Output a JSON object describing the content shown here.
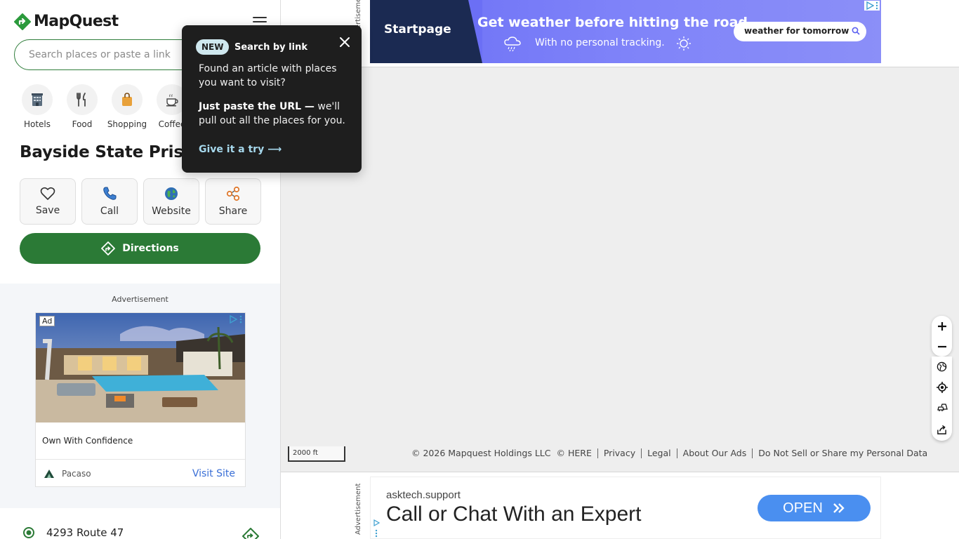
{
  "brand": {
    "name": "MapQuest"
  },
  "search": {
    "placeholder": "Search places or paste a link"
  },
  "categories": [
    {
      "label": "Hotels",
      "icon": "hotel-icon"
    },
    {
      "label": "Food",
      "icon": "fork-knife-icon"
    },
    {
      "label": "Shopping",
      "icon": "shopping-bag-icon"
    },
    {
      "label": "Coffee",
      "icon": "coffee-cup-icon"
    }
  ],
  "place": {
    "title": "Bayside State Prison",
    "actions": [
      {
        "label": "Save",
        "icon": "heart-icon"
      },
      {
        "label": "Call",
        "icon": "phone-icon"
      },
      {
        "label": "Website",
        "icon": "globe-icon"
      },
      {
        "label": "Share",
        "icon": "share-icon"
      }
    ],
    "directions_label": "Directions",
    "address": "4293 Route 47"
  },
  "popover": {
    "badge": "NEW",
    "title": "Search by link",
    "body1": "Found an article with places you want to visit?",
    "body2_bold": "Just paste the URL —",
    "body2_rest": " we'll pull out all the places for you.",
    "link": "Give it a try ⟶"
  },
  "left_ad": {
    "label": "Advertisement",
    "tag": "Ad",
    "headline": "Own With Confidence",
    "brand": "Pacaso",
    "cta": "Visit Site"
  },
  "top_ad": {
    "side_label": "Advertisement",
    "brand": "Startpage",
    "headline": "Get weather before hitting the road.",
    "sub": "With no personal tracking.",
    "search_text": "weather for tomorrow"
  },
  "map": {
    "scale_label": "2000 ft",
    "footer": {
      "copyright": "© 2026 Mapquest Holdings LLC",
      "here": "© HERE",
      "links": [
        "Privacy",
        "Legal",
        "About Our Ads",
        "Do Not Sell or Share my Personal Data"
      ]
    },
    "controls": [
      "zoom-in-icon",
      "zoom-out-icon",
      "globe-icon",
      "locate-icon",
      "traffic-icon",
      "share-map-icon"
    ]
  },
  "bottom_ad": {
    "side_label": "Advertisement",
    "domain": "asktech.support",
    "headline": "Call or Chat With an Expert",
    "cta": "OPEN"
  },
  "colors": {
    "accent_green": "#2b7a36",
    "popover_bg": "#1e1e1e",
    "popover_link": "#a6d8ec",
    "map_bg": "#eeeeee",
    "ad_cta_blue": "#4a8ff0"
  }
}
